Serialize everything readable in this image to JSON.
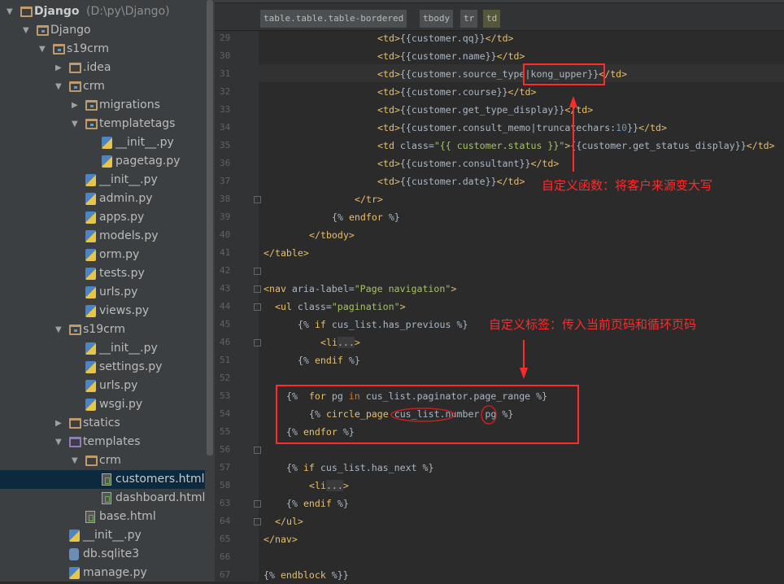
{
  "tree": [
    {
      "lvl": 0,
      "arrow": "down",
      "icon": "folder",
      "label": "Django",
      "extra": " (D:\\py\\Django)",
      "bold": true
    },
    {
      "lvl": 1,
      "arrow": "down",
      "icon": "module",
      "label": "Django"
    },
    {
      "lvl": 2,
      "arrow": "down",
      "icon": "module",
      "label": "s19crm"
    },
    {
      "lvl": 3,
      "arrow": "right",
      "icon": "folder",
      "label": ".idea"
    },
    {
      "lvl": 3,
      "arrow": "down",
      "icon": "module",
      "label": "crm"
    },
    {
      "lvl": 4,
      "arrow": "right",
      "icon": "module",
      "label": "migrations"
    },
    {
      "lvl": 4,
      "arrow": "down",
      "icon": "module",
      "label": "templatetags"
    },
    {
      "lvl": 5,
      "icon": "py",
      "label": "__init__.py"
    },
    {
      "lvl": 5,
      "icon": "py",
      "label": "pagetag.py"
    },
    {
      "lvl": 4,
      "icon": "py",
      "label": "__init__.py"
    },
    {
      "lvl": 4,
      "icon": "py",
      "label": "admin.py"
    },
    {
      "lvl": 4,
      "icon": "py",
      "label": "apps.py"
    },
    {
      "lvl": 4,
      "icon": "py",
      "label": "models.py"
    },
    {
      "lvl": 4,
      "icon": "py",
      "label": "orm.py"
    },
    {
      "lvl": 4,
      "icon": "py",
      "label": "tests.py"
    },
    {
      "lvl": 4,
      "icon": "py",
      "label": "urls.py"
    },
    {
      "lvl": 4,
      "icon": "py",
      "label": "views.py"
    },
    {
      "lvl": 3,
      "arrow": "down",
      "icon": "module",
      "label": "s19crm"
    },
    {
      "lvl": 4,
      "icon": "py",
      "label": "__init__.py"
    },
    {
      "lvl": 4,
      "icon": "py",
      "label": "settings.py"
    },
    {
      "lvl": 4,
      "icon": "py",
      "label": "urls.py"
    },
    {
      "lvl": 4,
      "icon": "py",
      "label": "wsgi.py"
    },
    {
      "lvl": 3,
      "arrow": "right",
      "icon": "folder",
      "label": "statics"
    },
    {
      "lvl": 3,
      "arrow": "down",
      "icon": "template-folder",
      "label": "templates"
    },
    {
      "lvl": 4,
      "arrow": "down",
      "icon": "folder",
      "label": "crm"
    },
    {
      "lvl": 5,
      "icon": "html",
      "label": "customers.html",
      "selected": true
    },
    {
      "lvl": 5,
      "icon": "html",
      "label": "dashboard.html"
    },
    {
      "lvl": 4,
      "icon": "html",
      "label": "base.html"
    },
    {
      "lvl": 3,
      "icon": "py",
      "label": "__init__.py"
    },
    {
      "lvl": 3,
      "icon": "db",
      "label": "db.sqlite3"
    },
    {
      "lvl": 3,
      "icon": "py",
      "label": "manage.py"
    }
  ],
  "breadcrumb": [
    "table.table.table-bordered",
    "tbody",
    "tr",
    "td"
  ],
  "code": [
    {
      "n": "29",
      "i": 20,
      "s": [
        [
          "<td>",
          "t"
        ],
        [
          "{{customer.qq}}",
          "x"
        ],
        [
          "</td>",
          "t"
        ]
      ]
    },
    {
      "n": "30",
      "i": 20,
      "s": [
        [
          "<td>",
          "t"
        ],
        [
          "{{customer.name}}",
          "x"
        ],
        [
          "</td>",
          "t"
        ]
      ]
    },
    {
      "n": "31",
      "i": 20,
      "s": [
        [
          "<td>",
          "t"
        ],
        [
          "{{customer.source_type|kong_upper}}",
          "x"
        ],
        [
          "</td>",
          "t"
        ]
      ]
    },
    {
      "n": "32",
      "i": 20,
      "s": [
        [
          "<td>",
          "t"
        ],
        [
          "{{customer.course}}",
          "x"
        ],
        [
          "</td>",
          "t"
        ]
      ]
    },
    {
      "n": "33",
      "i": 20,
      "s": [
        [
          "<td>",
          "t"
        ],
        [
          "{{customer.get_type_display}}",
          "x"
        ],
        [
          "</td>",
          "t"
        ]
      ]
    },
    {
      "n": "34",
      "i": 20,
      "s": [
        [
          "<td>",
          "t"
        ],
        [
          "{{customer.consult_memo|truncatechars:",
          "x"
        ],
        [
          "10",
          "n"
        ],
        [
          "}}",
          "x"
        ],
        [
          "</td>",
          "t"
        ]
      ]
    },
    {
      "n": "35",
      "i": 20,
      "s": [
        [
          "<td ",
          "t"
        ],
        [
          "class=",
          "x"
        ],
        [
          "\"{{ customer.status }}\"",
          "s"
        ],
        [
          ">",
          "t"
        ],
        [
          "{{customer.get_status_display}}",
          "x"
        ],
        [
          "</td>",
          "t"
        ]
      ]
    },
    {
      "n": "36",
      "i": 20,
      "s": [
        [
          "<td>",
          "t"
        ],
        [
          "{{customer.consultant}}",
          "x"
        ],
        [
          "</td>",
          "t"
        ]
      ]
    },
    {
      "n": "37",
      "i": 20,
      "s": [
        [
          "<td>",
          "t"
        ],
        [
          "{{customer.date}}",
          "x"
        ],
        [
          "</td>",
          "t"
        ]
      ]
    },
    {
      "n": "38",
      "i": 16,
      "s": [
        [
          "</tr>",
          "t"
        ]
      ]
    },
    {
      "n": "39",
      "i": 12,
      "s": [
        [
          "{% ",
          "x"
        ],
        [
          "endfor",
          "m"
        ],
        [
          " %}",
          "x"
        ]
      ]
    },
    {
      "n": "40",
      "i": 8,
      "s": [
        [
          "</tbody>",
          "t"
        ]
      ]
    },
    {
      "n": "41",
      "i": 0,
      "s": [
        [
          "</table>",
          "t"
        ]
      ]
    },
    {
      "n": "42",
      "i": 0,
      "s": []
    },
    {
      "n": "43",
      "i": 0,
      "s": [
        [
          "<nav ",
          "t"
        ],
        [
          "aria-label=",
          "x"
        ],
        [
          "\"Page navigation\"",
          "s"
        ],
        [
          ">",
          "t"
        ]
      ]
    },
    {
      "n": "44",
      "i": 2,
      "s": [
        [
          "<ul ",
          "t"
        ],
        [
          "class=",
          "x"
        ],
        [
          "\"pagination\"",
          "s"
        ],
        [
          ">",
          "t"
        ]
      ]
    },
    {
      "n": "45",
      "i": 6,
      "s": [
        [
          "{% ",
          "x"
        ],
        [
          "if",
          "m"
        ],
        [
          " cus_list.has_previous %}",
          "x"
        ]
      ]
    },
    {
      "n": "46",
      "i": 10,
      "s": [
        [
          "<li",
          "t"
        ],
        [
          "...",
          "f"
        ],
        [
          ">",
          "t"
        ]
      ]
    },
    {
      "n": "51",
      "i": 6,
      "s": [
        [
          "{% ",
          "x"
        ],
        [
          "endif",
          "m"
        ],
        [
          " %}",
          "x"
        ]
      ]
    },
    {
      "n": "52",
      "i": 0,
      "s": []
    },
    {
      "n": "53",
      "i": 4,
      "s": [
        [
          "{%  ",
          "x"
        ],
        [
          "for",
          "m"
        ],
        [
          " pg ",
          "x"
        ],
        [
          "in",
          "k"
        ],
        [
          " cus_list.paginator.page_range %}",
          "x"
        ]
      ]
    },
    {
      "n": "54",
      "i": 8,
      "s": [
        [
          "{% ",
          "x"
        ],
        [
          "circle_page",
          "m"
        ],
        [
          " cus_list.number pg %}",
          "x"
        ]
      ]
    },
    {
      "n": "55",
      "i": 4,
      "s": [
        [
          "{% ",
          "x"
        ],
        [
          "endfor",
          "m"
        ],
        [
          " %}",
          "x"
        ]
      ]
    },
    {
      "n": "56",
      "i": 0,
      "s": []
    },
    {
      "n": "57",
      "i": 4,
      "s": [
        [
          "{% ",
          "x"
        ],
        [
          "if",
          "m"
        ],
        [
          " cus_list.has_next %}",
          "x"
        ]
      ]
    },
    {
      "n": "58",
      "i": 8,
      "s": [
        [
          "<li",
          "t"
        ],
        [
          "...",
          "f"
        ],
        [
          ">",
          "t"
        ]
      ]
    },
    {
      "n": "63",
      "i": 4,
      "s": [
        [
          "{% ",
          "x"
        ],
        [
          "endif",
          "m"
        ],
        [
          " %}",
          "x"
        ]
      ]
    },
    {
      "n": "64",
      "i": 2,
      "s": [
        [
          "</ul>",
          "t"
        ]
      ]
    },
    {
      "n": "65",
      "i": 0,
      "s": [
        [
          "</nav>",
          "t"
        ]
      ]
    },
    {
      "n": "66",
      "i": 0,
      "s": []
    },
    {
      "n": "67",
      "i": 0,
      "s": [
        [
          "{% ",
          "x"
        ],
        [
          "endblock",
          "m"
        ],
        [
          " %}}",
          "x"
        ]
      ]
    }
  ],
  "annotations": {
    "filter_note": "自定义函数：将客户来源变大写",
    "tag_note": "自定义标签：传入当前页码和循环页码"
  },
  "colors": {
    "annotation": "#ff2b2b",
    "tag": "#e8bf6a",
    "string": "#a5c261",
    "selected_row": "#0d293e"
  }
}
